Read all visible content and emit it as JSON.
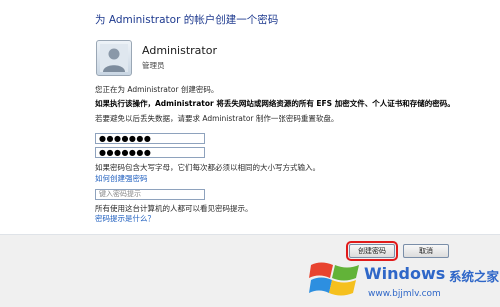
{
  "dialog": {
    "title": "为 Administrator 的帐户创建一个密码",
    "account_name": "Administrator",
    "account_type": "管理员",
    "intro": "您正在为 Administrator 创建密码。",
    "warning": "如果执行该操作，Administrator 将丢失网站或网络资源的所有 EFS 加密文件、个人证书和存储的密码。",
    "reset_tip": "若要避免以后丢失数据，请要求 Administrator 制作一张密码重置软盘。",
    "password_value": "●●●●●●●",
    "confirm_value": "●●●●●●●",
    "case_note": "如果密码包含大写字母，它们每次都必须以相同的大小写方式输入。",
    "strong_link": "如何创建强密码",
    "hint_placeholder": "键入密码提示",
    "hint_note": "所有使用这台计算机的人都可以看见密码提示。",
    "hint_link": "密码提示是什么？"
  },
  "footer": {
    "create_label": "创建密码",
    "cancel_label": "取消"
  },
  "watermark": {
    "brand": "Windows",
    "brand_zh": "系统之家",
    "site": "www.bjjmlv.com"
  },
  "colors": {
    "title": "#1e3a8f",
    "link": "#1f5fbf",
    "highlight": "#e11b1b",
    "brand": "#2f67c8"
  },
  "icons": [
    "user-avatar-icon",
    "windows-logo-icon"
  ]
}
